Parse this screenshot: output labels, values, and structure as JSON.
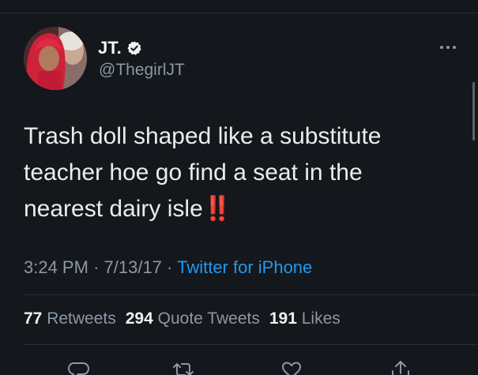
{
  "tweet": {
    "author": {
      "display_name": "JT.",
      "handle": "@ThegirlJT",
      "verified": true
    },
    "text_lines": [
      "Trash doll shaped like a substitute",
      "teacher hoe go find a seat in the",
      "nearest dairy isle"
    ],
    "text_emoji": "‼️",
    "time": "3:24 PM",
    "separator": "·",
    "date": "7/13/17",
    "source": "Twitter for iPhone",
    "stats": {
      "retweets_count": "77",
      "retweets_label": "Retweets",
      "quote_count": "294",
      "quote_label": "Quote Tweets",
      "likes_count": "191",
      "likes_label": "Likes"
    }
  },
  "icons": {
    "more": "more-horizontal-icon",
    "reply": "reply-icon",
    "retweet": "retweet-icon",
    "like": "like-icon",
    "share": "share-icon",
    "verified": "verified-badge-icon"
  },
  "colors": {
    "background": "#14171c",
    "text": "#ececec",
    "muted": "#8b98a5",
    "link": "#1d9bf0",
    "emoji_red": "#e0292d"
  }
}
